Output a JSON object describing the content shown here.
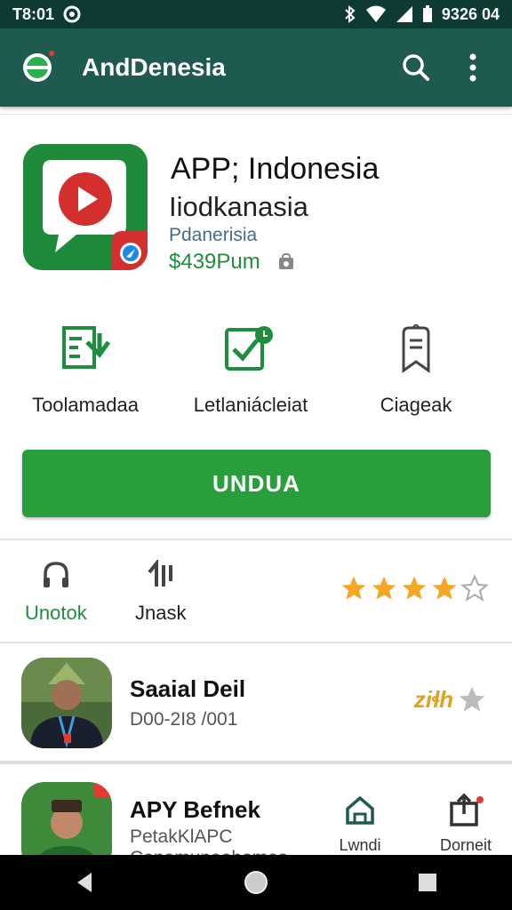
{
  "status_bar": {
    "time": "T8:01",
    "right_text": "9326 04"
  },
  "app_bar": {
    "title": "AndDenesia"
  },
  "app": {
    "name": "APP; Indonesia",
    "subtitle": "Iiodkanasia",
    "developer": "Pdanerisia",
    "price": "$439Pum"
  },
  "features": [
    {
      "label": "Toolamadaa",
      "icon": "download-doc-icon"
    },
    {
      "label": "Letlaniácleiat",
      "icon": "verified-doc-icon"
    },
    {
      "label": "Ciageak",
      "icon": "bookmark-icon"
    }
  ],
  "install_button": {
    "label": "UNDUA"
  },
  "stats": [
    {
      "label": "Unotok",
      "icon": "headphones-icon",
      "color": "#1e8e3e"
    },
    {
      "label": "Jnask",
      "icon": "rating-icon",
      "color": "#222222"
    }
  ],
  "rating": {
    "filled": 4,
    "total": 5
  },
  "reviews": [
    {
      "name": "Saaial Deil",
      "meta": "D00-2I8 /001",
      "rating_text": "ziɬh",
      "avatar": "man-lanyard-avatar"
    },
    {
      "name": "APY Befnek",
      "meta": "PetakKlAPC",
      "extra": "Conamunoohomas",
      "avatar": "man-cap-avatar",
      "action1": "Lwndi",
      "action2": "Dorneit"
    }
  ],
  "colors": {
    "primary": "#1e5a50",
    "status": "#0d3b34",
    "accent": "#2a9d3d",
    "star": "#f5a623"
  }
}
